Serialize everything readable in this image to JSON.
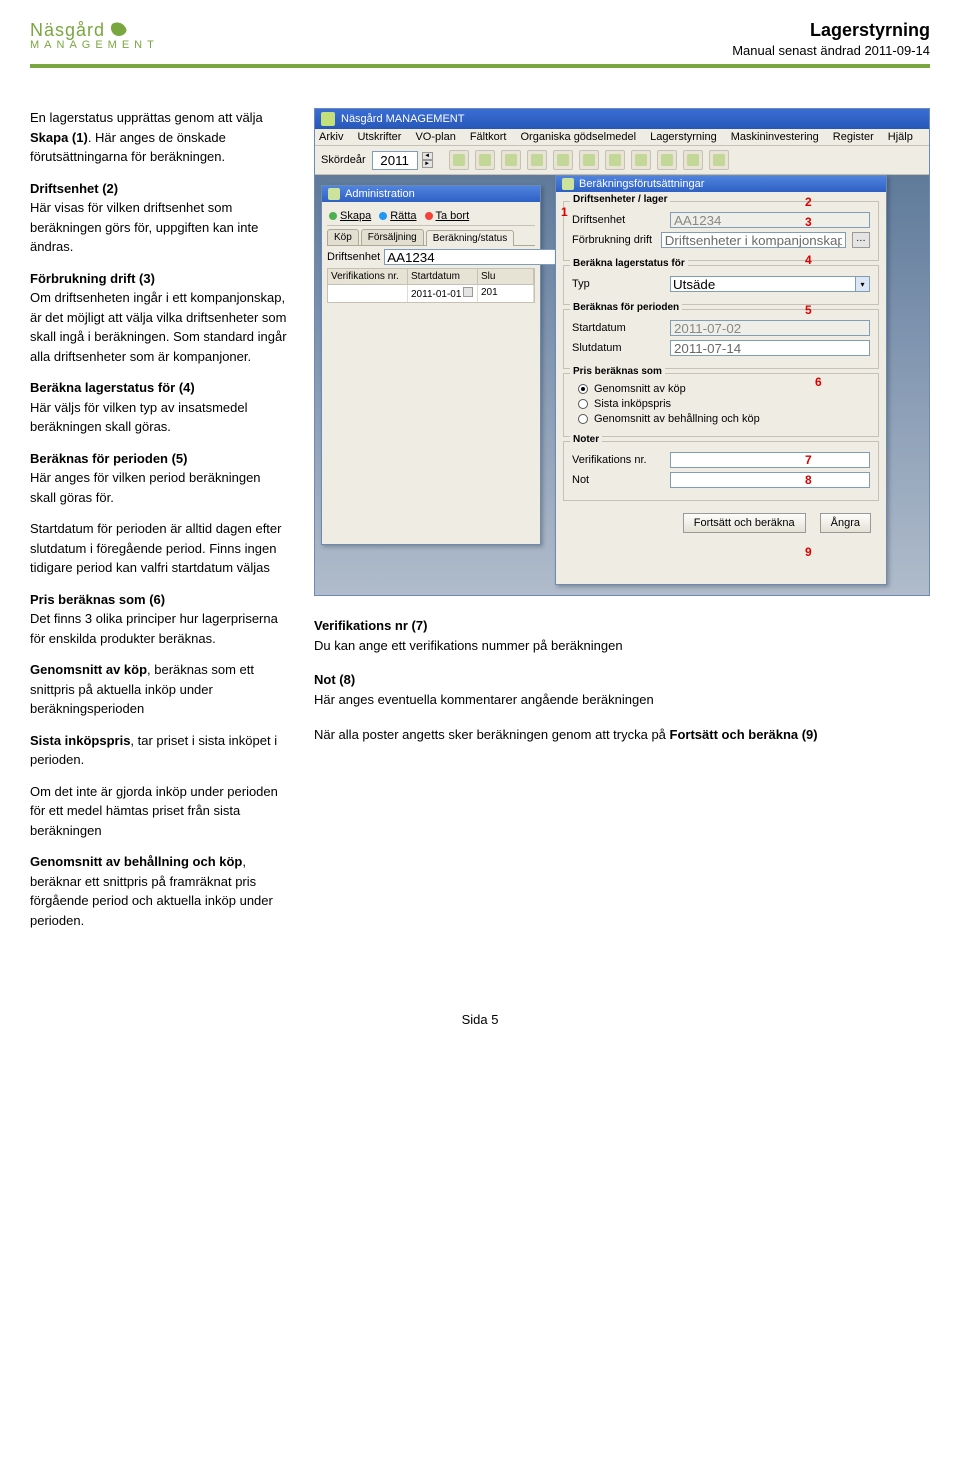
{
  "header": {
    "logo_line1": "Näsgård",
    "logo_line2": "MANAGEMENT",
    "title": "Lagerstyrning",
    "subtitle": "Manual senast ändrad 2011-09-14"
  },
  "left": {
    "p1a": "En lagerstatus upprättas genom att välja ",
    "p1b": "Skapa (1)",
    "p1c": ". Här anges de önskade förutsättningarna för beräkningen.",
    "h2": "Driftsenhet (2)",
    "p2": "Här visas för vilken driftsenhet som beräkningen görs för, uppgiften kan inte ändras.",
    "h3": "Förbrukning drift (3)",
    "p3": "Om driftsenheten ingår i ett kompanjonskap, är det möjligt att välja vilka driftsenheter som skall ingå i beräkningen. Som standard ingår alla driftsenheter som är kompanjoner.",
    "h4": "Beräkna lagerstatus för (4)",
    "p4": "Här väljs för vilken typ av insatsmedel beräkningen skall göras.",
    "h5": "Beräknas för perioden (5)",
    "p5": "Här anges för vilken period beräkningen skall göras för.",
    "p5b": "Startdatum för perioden är alltid dagen efter slutdatum i föregående period. Finns ingen tidigare period kan valfri startdatum väljas",
    "h6": "Pris beräknas som (6)",
    "p6": "Det finns 3 olika principer hur lagerpriserna för enskilda produkter beräknas.",
    "p6b_a": "Genomsnitt av köp",
    "p6b_b": ", beräknas som ett snittpris på aktuella inköp under beräkningsperioden",
    "p6c_a": "Sista inköpspris",
    "p6c_b": ", tar priset i sista inköpet i perioden.",
    "p6d": "Om det inte är gjorda inköp under perioden för ett medel hämtas priset från sista beräkningen",
    "p6e_a": "Genomsnitt av behållning och köp",
    "p6e_b": ", beräknar ett snittpris på framräknat pris förgående period och aktuella inköp under perioden."
  },
  "right_text": {
    "h7": "Verifikations nr (7)",
    "p7": "Du kan ange ett verifikations nummer på beräkningen",
    "h8": "Not (8)",
    "p8": "Här anges eventuella kommentarer angående beräkningen",
    "p9a": "När alla poster angetts sker beräkningen genom att trycka på ",
    "p9b": "Fortsätt och beräkna (9)"
  },
  "app": {
    "title": "Näsgård MANAGEMENT",
    "menu": [
      "Arkiv",
      "Utskrifter",
      "VO-plan",
      "Fältkort",
      "Organiska gödselmedel",
      "Lagerstyrning",
      "Maskininvestering",
      "Register",
      "Hjälp"
    ],
    "year_label": "Skördeår",
    "year_value": "2011"
  },
  "admin": {
    "title": "Administration",
    "btn_skapa": "Skapa",
    "btn_ratta": "Rätta",
    "btn_tabort": "Ta bort",
    "tabs": [
      "Köp",
      "Försäljning",
      "Beräkning/status"
    ],
    "drift_label": "Driftsenhet",
    "drift_value": "AA1234",
    "col1": "Verifikations nr.",
    "col2": "Startdatum",
    "col3": "Slu",
    "row_start": "2011-01-01",
    "row_end": "201"
  },
  "settings": {
    "title": "Beräkningsförutsättningar",
    "g1": "Driftsenheter / lager",
    "drift_label": "Driftsenhet",
    "drift_value": "AA1234",
    "forb_label": "Förbrukning drift",
    "forb_value": "Driftsenheter i kompanjonskap",
    "g2": "Beräkna lagerstatus för",
    "typ_label": "Typ",
    "typ_value": "Utsäde",
    "g3": "Beräknas för perioden",
    "start_label": "Startdatum",
    "start_value": "2011-07-02",
    "slut_label": "Slutdatum",
    "slut_value": "2011-07-14",
    "g4": "Pris beräknas som",
    "r1": "Genomsnitt av köp",
    "r2": "Sista inköpspris",
    "r3": "Genomsnitt av behållning och köp",
    "g5": "Noter",
    "ver_label": "Verifikations nr.",
    "not_label": "Not",
    "btn_ok": "Fortsätt och beräkna",
    "btn_cancel": "Ångra"
  },
  "footer": "Sida 5",
  "numbers": {
    "n1": "1",
    "n2": "2",
    "n3": "3",
    "n4": "4",
    "n5": "5",
    "n6": "6",
    "n7": "7",
    "n8": "8",
    "n9": "9"
  }
}
